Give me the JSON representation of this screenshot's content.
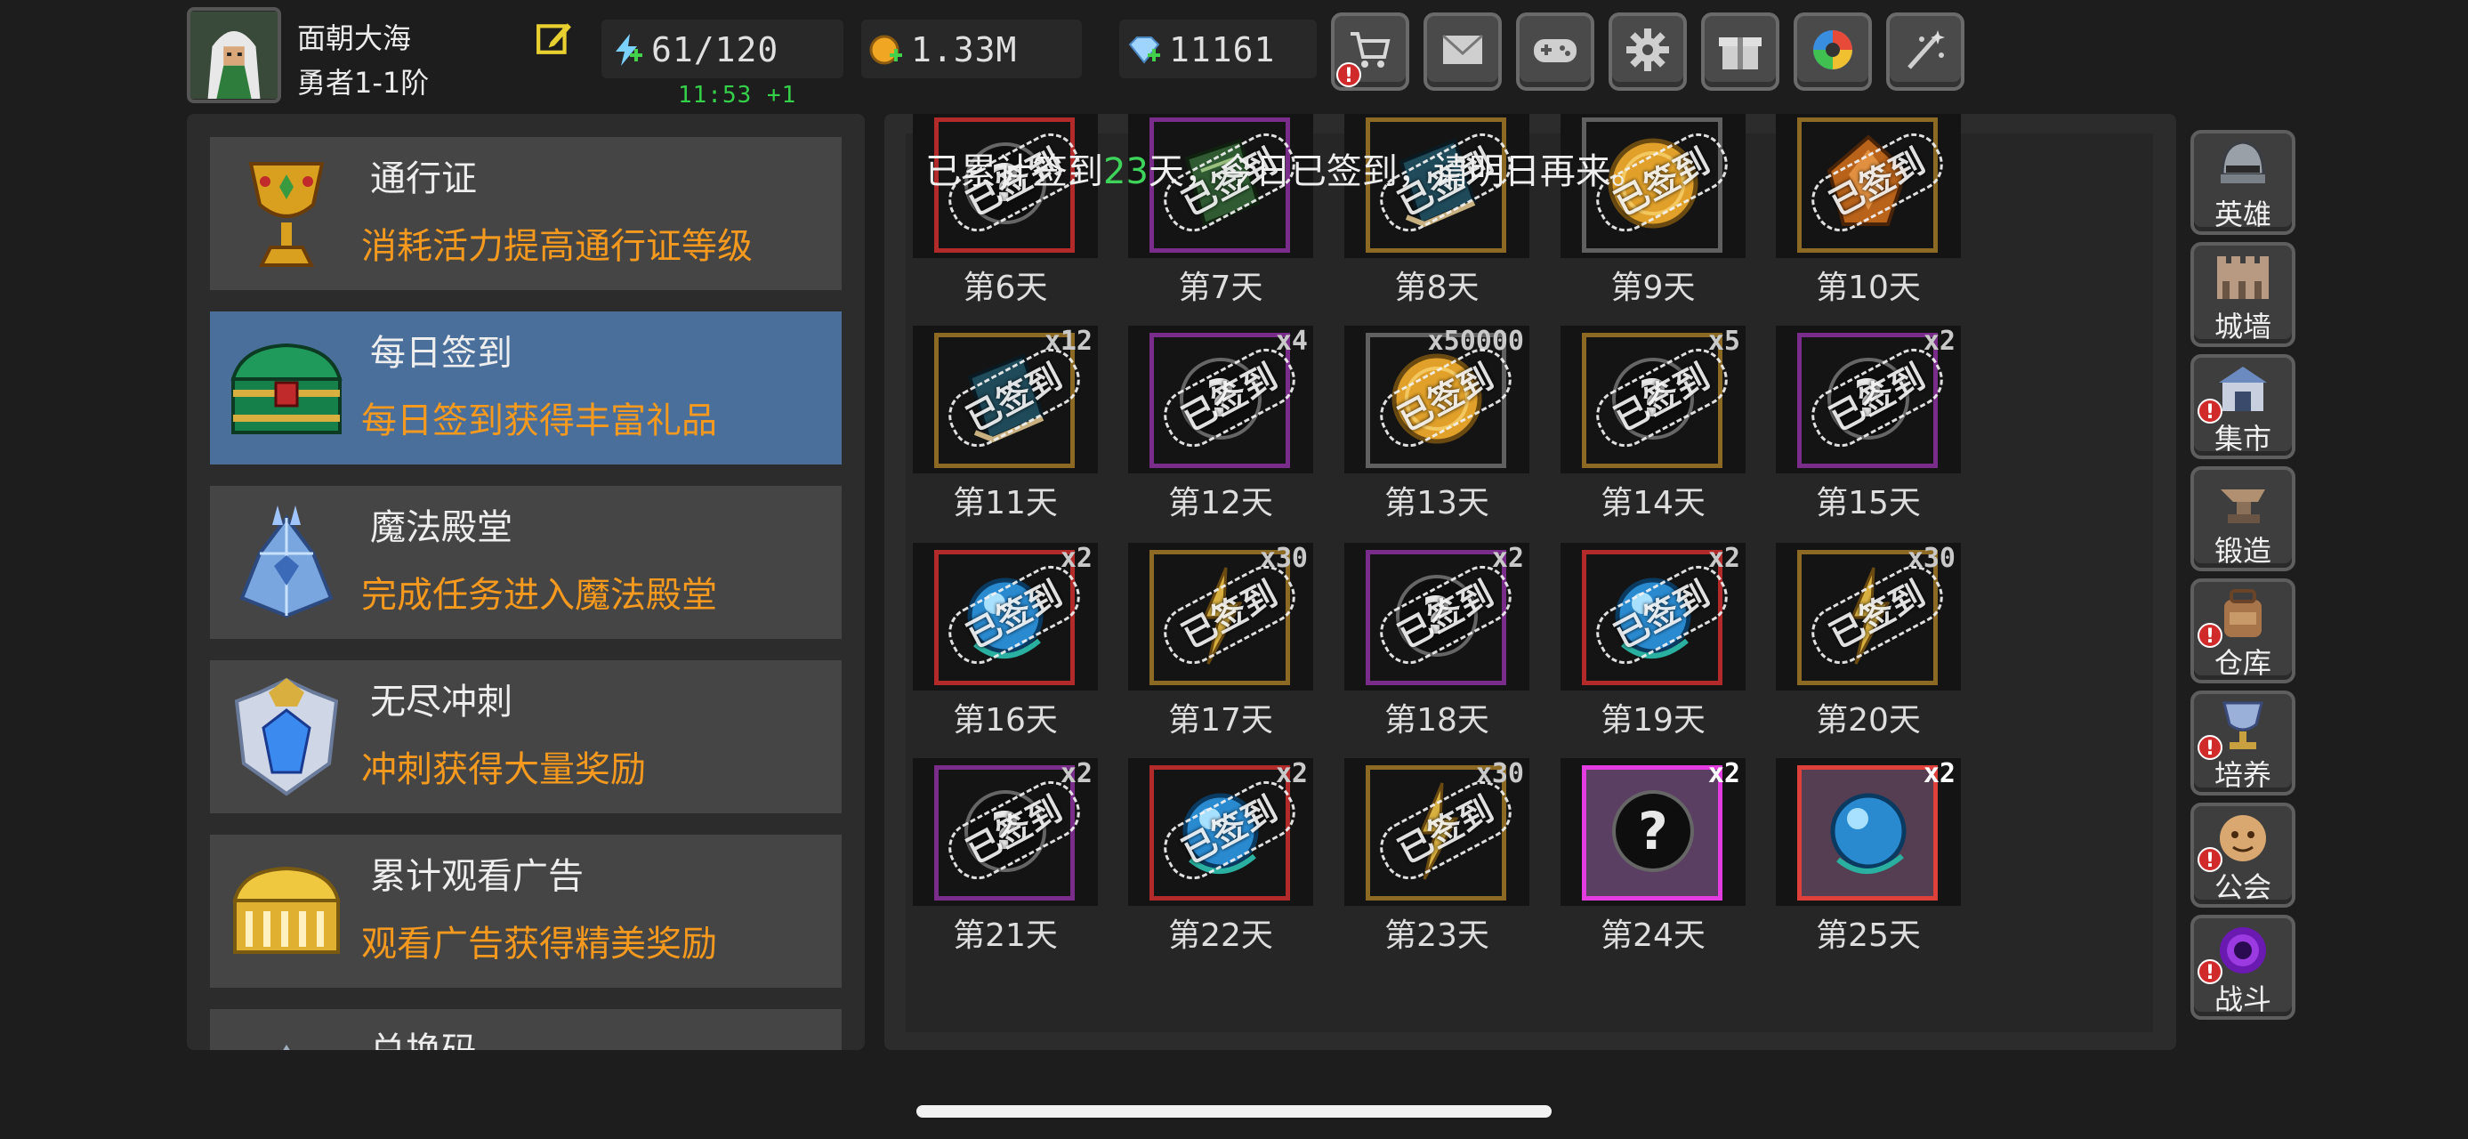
{
  "player": {
    "name": "面朝大海",
    "rank": "勇者1-1阶"
  },
  "resources": {
    "energy": "61/120",
    "energy_timer": "11:53 +1",
    "gold": "1.33M",
    "gems": "11161"
  },
  "toolbar": [
    {
      "name": "shop",
      "icon": "cart-icon",
      "alert": "!"
    },
    {
      "name": "mail",
      "icon": "envelope-icon"
    },
    {
      "name": "gamepad",
      "icon": "gamepad-icon"
    },
    {
      "name": "settings",
      "icon": "gear-icon"
    },
    {
      "name": "gift",
      "icon": "gift-icon"
    },
    {
      "name": "camera",
      "icon": "aperture-icon"
    },
    {
      "name": "fireworks",
      "icon": "sparkle-icon"
    }
  ],
  "menu": [
    {
      "title": "通行证",
      "desc": "消耗活力提高通行证等级",
      "icon": "goblet-icon",
      "active": false
    },
    {
      "title": "每日签到",
      "desc": "每日签到获得丰富礼品",
      "icon": "chest-icon",
      "active": true
    },
    {
      "title": "魔法殿堂",
      "desc": "完成任务进入魔法殿堂",
      "icon": "crystal-icon",
      "active": false
    },
    {
      "title": "无尽冲刺",
      "desc": "冲刺获得大量奖励",
      "icon": "shield-gem-icon",
      "active": false
    },
    {
      "title": "累计观看广告",
      "desc": "观看广告获得精美奖励",
      "icon": "gold-chest-icon",
      "active": false
    },
    {
      "title": "兑换码",
      "desc": "",
      "icon": "code-icon",
      "active": false
    }
  ],
  "signin": {
    "msg_before": "已累计签到",
    "days": "23",
    "msg_after": "天，今日已签到，请明日再来。",
    "stamp": "已签到"
  },
  "days": [
    {
      "label": "第6天",
      "qty": "",
      "frame": "red",
      "item": "mystery",
      "signed": true
    },
    {
      "label": "第7天",
      "qty": "",
      "frame": "purple",
      "item": "green-book",
      "signed": true
    },
    {
      "label": "第8天",
      "qty": "",
      "frame": "gold",
      "item": "book",
      "signed": true
    },
    {
      "label": "第9天",
      "qty": "",
      "frame": "grey",
      "item": "coin",
      "signed": true
    },
    {
      "label": "第10天",
      "qty": "",
      "frame": "gold",
      "item": "amber",
      "signed": true
    },
    {
      "label": "第11天",
      "qty": "x12",
      "frame": "gold",
      "item": "book",
      "signed": true
    },
    {
      "label": "第12天",
      "qty": "x4",
      "frame": "purple",
      "item": "mystery",
      "signed": true
    },
    {
      "label": "第13天",
      "qty": "x50000",
      "frame": "grey",
      "item": "coin",
      "signed": true
    },
    {
      "label": "第14天",
      "qty": "x5",
      "frame": "gold",
      "item": "mystery",
      "signed": true
    },
    {
      "label": "第15天",
      "qty": "x2",
      "frame": "purple",
      "item": "mystery",
      "signed": true
    },
    {
      "label": "第16天",
      "qty": "x2",
      "frame": "red",
      "item": "orb",
      "signed": true
    },
    {
      "label": "第17天",
      "qty": "x30",
      "frame": "gold",
      "item": "shard",
      "signed": true
    },
    {
      "label": "第18天",
      "qty": "x2",
      "frame": "purple",
      "item": "mystery",
      "signed": true
    },
    {
      "label": "第19天",
      "qty": "x2",
      "frame": "red",
      "item": "orb",
      "signed": true
    },
    {
      "label": "第20天",
      "qty": "x30",
      "frame": "gold",
      "item": "shard",
      "signed": true
    },
    {
      "label": "第21天",
      "qty": "x2",
      "frame": "purple",
      "item": "mystery",
      "signed": true
    },
    {
      "label": "第22天",
      "qty": "x2",
      "frame": "red",
      "item": "orb",
      "signed": true
    },
    {
      "label": "第23天",
      "qty": "x30",
      "frame": "gold",
      "item": "shard",
      "signed": true
    },
    {
      "label": "第24天",
      "qty": "x2",
      "frame": "magenta",
      "item": "mystery",
      "signed": false
    },
    {
      "label": "第25天",
      "qty": "x2",
      "frame": "bright-red",
      "item": "orb",
      "signed": false
    }
  ],
  "sidebar": [
    {
      "label": "英雄",
      "icon": "helmet-icon",
      "alert": ""
    },
    {
      "label": "城墙",
      "icon": "wall-icon",
      "alert": ""
    },
    {
      "label": "集市",
      "icon": "market-icon",
      "alert": "!"
    },
    {
      "label": "锻造",
      "icon": "anvil-icon",
      "alert": ""
    },
    {
      "label": "仓库",
      "icon": "backpack-icon",
      "alert": "!"
    },
    {
      "label": "培养",
      "icon": "grail-icon",
      "alert": "!"
    },
    {
      "label": "公会",
      "icon": "guild-icon",
      "alert": "!"
    },
    {
      "label": "战斗",
      "icon": "portal-icon",
      "alert": "!"
    }
  ]
}
